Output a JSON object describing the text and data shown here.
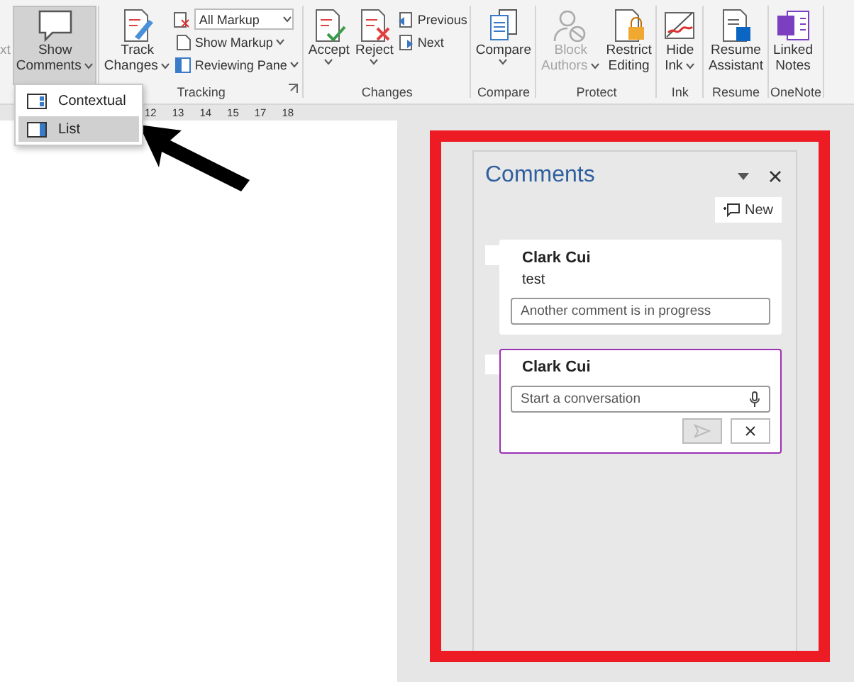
{
  "ribbon": {
    "cut_label": "xt",
    "groups": [
      {
        "buttons": [
          {
            "kind": "large",
            "lines": [
              "Show",
              "Comments"
            ],
            "dropdown": true,
            "selected": true,
            "disabled": false
          }
        ]
      },
      {
        "label": "Tracking",
        "launcher": true,
        "buttons": [
          {
            "kind": "large",
            "lines": [
              "Track",
              "Changes"
            ],
            "dropdown": true,
            "selected": false,
            "disabled": false
          },
          {
            "kind": "stack",
            "items": [
              {
                "kind": "combo",
                "label": "All Markup"
              },
              {
                "kind": "small",
                "label": "Show Markup",
                "dropdown": true
              },
              {
                "kind": "small",
                "label": "Reviewing Pane",
                "dropdown": true
              }
            ]
          }
        ]
      },
      {
        "label": "Changes",
        "buttons": [
          {
            "kind": "large",
            "lines": [
              "Accept"
            ],
            "dropdown": true,
            "selected": false,
            "disabled": false
          },
          {
            "kind": "large",
            "lines": [
              "Reject"
            ],
            "dropdown": true,
            "selected": false,
            "disabled": false
          },
          {
            "kind": "stack",
            "items": [
              {
                "kind": "small",
                "label": "Previous",
                "dropdown": false
              },
              {
                "kind": "small",
                "label": "Next",
                "dropdown": false
              }
            ]
          }
        ]
      },
      {
        "label": "Compare",
        "buttons": [
          {
            "kind": "large",
            "lines": [
              "Compare"
            ],
            "dropdown": true,
            "selected": false,
            "disabled": false
          }
        ]
      },
      {
        "label": "Protect",
        "buttons": [
          {
            "kind": "large",
            "lines": [
              "Block",
              "Authors"
            ],
            "dropdown": true,
            "selected": false,
            "disabled": true
          },
          {
            "kind": "large",
            "lines": [
              "Restrict",
              "Editing"
            ],
            "dropdown": false,
            "selected": false,
            "disabled": false
          }
        ]
      },
      {
        "label": "Ink",
        "buttons": [
          {
            "kind": "large",
            "lines": [
              "Hide",
              "Ink"
            ],
            "dropdown": true,
            "selected": false,
            "disabled": false
          }
        ]
      },
      {
        "label": "Resume",
        "buttons": [
          {
            "kind": "large",
            "lines": [
              "Resume",
              "Assistant"
            ],
            "dropdown": false,
            "selected": false,
            "disabled": false
          }
        ]
      },
      {
        "label": "OneNote",
        "buttons": [
          {
            "kind": "large",
            "lines": [
              "Linked",
              "Notes"
            ],
            "dropdown": false,
            "selected": false,
            "disabled": false
          }
        ]
      }
    ]
  },
  "show_comments_menu": {
    "items": [
      {
        "label": "Contextual",
        "selected": false
      },
      {
        "label": "List",
        "selected": true
      }
    ]
  },
  "ruler": {
    "marks": [
      "12",
      "13",
      "14",
      "15",
      "17",
      "18"
    ]
  },
  "comments_pane": {
    "title": "Comments",
    "new_button": "New",
    "threads": [
      {
        "author": "Clark Cui",
        "text": "test",
        "reply_placeholder": "Another comment is in progress",
        "active": false
      },
      {
        "author": "Clark Cui",
        "reply_placeholder": "Start a conversation",
        "active": true
      }
    ]
  }
}
